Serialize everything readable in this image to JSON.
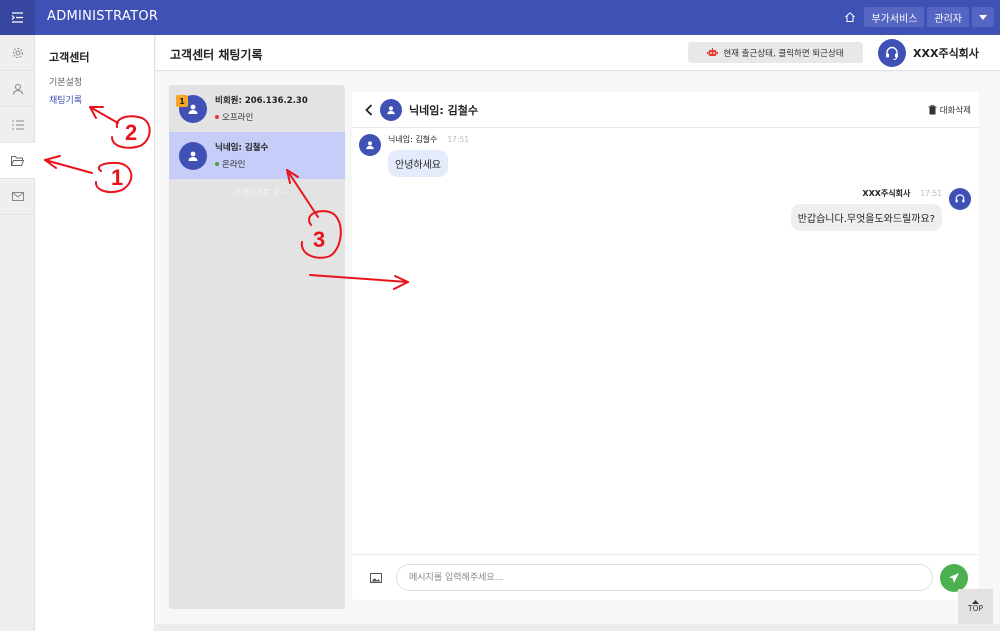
{
  "app": {
    "brand": "ADMINISTRATOR"
  },
  "topbar": {
    "service_label": "부가서비스",
    "admin_label": "관리자"
  },
  "subnav": {
    "title": "고객센터",
    "items": [
      {
        "label": "기본설정"
      },
      {
        "label": "채팅기록"
      }
    ]
  },
  "header": {
    "title": "고객센터 채팅기록",
    "status_text": "현재 출근상태, 클릭하면 퇴근상태",
    "company": "XXX주식회사"
  },
  "chat_list": {
    "items": [
      {
        "name": "비회원: 206.136.2.30",
        "status": "오프라인",
        "badge": "1",
        "status_color": "#e53935"
      },
      {
        "name": "닉네임: 김철수",
        "status": "온라인",
        "status_color": "#43a047"
      }
    ],
    "footer": "--고객리스트 끝--"
  },
  "chat": {
    "title": "닉네임: 김철수",
    "delete_label": "대화삭제",
    "messages": [
      {
        "sender": "닉네임: 김철수",
        "time": "17:51",
        "text": "안녕하세요"
      },
      {
        "sender": "XXX주식회사",
        "time": "17:51",
        "text": "반갑습니다.무엇을도와드릴까요?"
      }
    ],
    "input_placeholder": "메시지를 입력해주세요..."
  },
  "top_label": "TOP",
  "annotations": [
    "1",
    "2",
    "3"
  ],
  "colors": {
    "primary": "#3f51b5",
    "send": "#4caf50",
    "badge": "#f5a623",
    "selected": "#c5cdf8",
    "annotation": "#e8141c"
  }
}
